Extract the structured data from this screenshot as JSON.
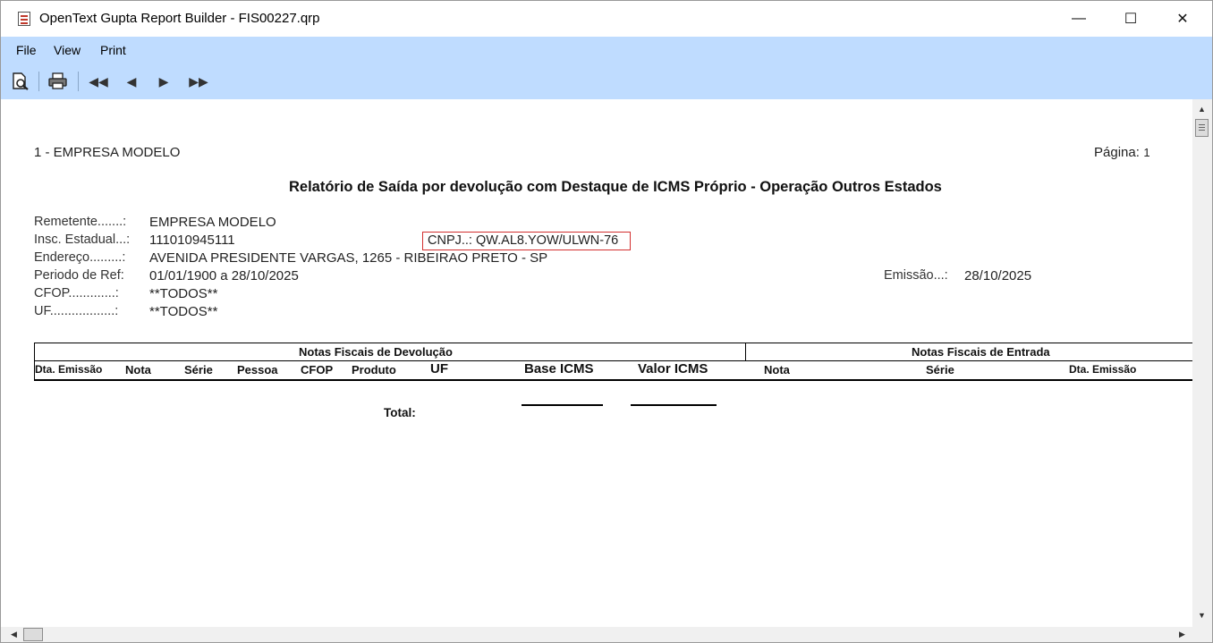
{
  "window": {
    "title": "OpenText Gupta Report Builder - FIS00227.qrp",
    "minimize_glyph": "—",
    "maximize_glyph": "☐",
    "close_glyph": "✕"
  },
  "menu": {
    "file": "File",
    "view": "View",
    "print": "Print"
  },
  "toolbar": {
    "icons": [
      "print-preview-icon",
      "printer-icon",
      "first-page-icon",
      "previous-page-icon",
      "next-page-icon",
      "last-page-icon"
    ],
    "glyphs": {
      "first": "◀◀",
      "prev": "◀",
      "next": "▶",
      "last": "▶▶"
    }
  },
  "report": {
    "company": "1 - EMPRESA MODELO",
    "page_label": "Página:",
    "page_number": "1",
    "title": "Relatório de Saída por devolução com Destaque de ICMS Próprio - Operação Outros Estados",
    "fields": {
      "remetente_label": "Remetente.......:",
      "remetente_value": "EMPRESA MODELO",
      "insc_label": "Insc. Estadual...:",
      "insc_value": "111010945111",
      "cnpj": "CNPJ..: QW.AL8.YOW/ULWN-76",
      "endereco_label": "Endereço.........:",
      "endereco_value": "AVENIDA PRESIDENTE VARGAS, 1265 - RIBEIRAO PRETO - SP",
      "periodo_label": "Periodo de Ref:",
      "periodo_value": "01/01/1900 a 28/10/2025",
      "emissao_label": "Emissão...:",
      "emissao_value": "28/10/2025",
      "cfop_label": "CFOP.............:",
      "cfop_value": "**TODOS**",
      "uf_label": "UF..................:",
      "uf_value": "**TODOS**"
    },
    "table": {
      "group_devolucao": "Notas Fiscais de Devolução",
      "group_entrada": "Notas Fiscais de Entrada",
      "columns": [
        "Dta. Emissão",
        "Nota",
        "Série",
        "Pessoa",
        "CFOP",
        "Produto",
        "UF",
        "Base ICMS",
        "Valor ICMS",
        "Nota",
        "Série",
        "Dta. Emissão"
      ]
    },
    "total_label": "Total:"
  },
  "colors": {
    "menu_bg": "#bfdcff",
    "highlight_border": "#d32f2f"
  }
}
